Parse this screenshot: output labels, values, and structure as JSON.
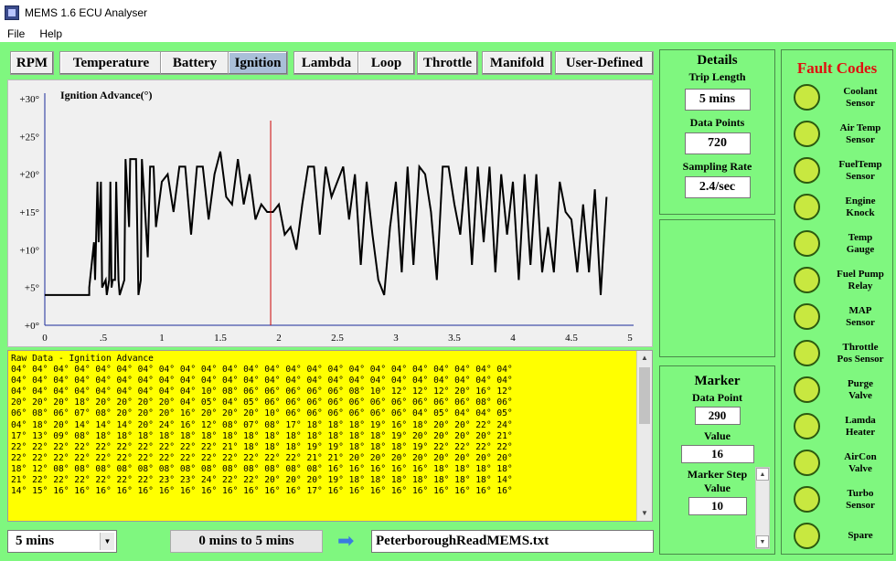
{
  "window": {
    "title": "MEMS 1.6 ECU Analyser"
  },
  "menu": [
    "File",
    "Help"
  ],
  "tabs": [
    {
      "label": "RPM",
      "active": false
    },
    {
      "label": "Temperature",
      "active": false
    },
    {
      "label": "Battery",
      "active": false
    },
    {
      "label": "Ignition",
      "active": true
    },
    {
      "label": "Lambda",
      "active": false
    },
    {
      "label": "Loop",
      "active": false
    },
    {
      "label": "Throttle",
      "active": false
    },
    {
      "label": "Manifold",
      "active": false
    },
    {
      "label": "User-Defined",
      "active": false
    }
  ],
  "chart_data": {
    "type": "line",
    "title": "Ignition Advance(°)",
    "xlabel": "",
    "ylabel": "",
    "xlim": [
      0,
      5
    ],
    "ylim": [
      0,
      30
    ],
    "x_ticks": [
      "0",
      ".5",
      "1",
      "1.5",
      "2",
      "2.5",
      "3",
      "3.5",
      "4",
      "4.5",
      "5"
    ],
    "y_ticks": [
      "+0°",
      "+5°",
      "+10°",
      "+15°",
      "+20°",
      "+25°",
      "+30°"
    ],
    "marker_x": 1.93,
    "line_color": "#000000",
    "marker_color": "#cc0000",
    "axis_color": "#1a2a9a",
    "series": [
      {
        "x": [
          0,
          0.38,
          0.38,
          0.42,
          0.43,
          0.45,
          0.46,
          0.48,
          0.49,
          0.52,
          0.53,
          0.55,
          0.56,
          0.57,
          0.58,
          0.6,
          0.61,
          0.63,
          0.64,
          0.68,
          0.69,
          0.72,
          0.73,
          0.78,
          0.8,
          0.82,
          0.83,
          0.85,
          0.88,
          0.9,
          0.93,
          0.95,
          1.0,
          1.05,
          1.1,
          1.15,
          1.2,
          1.25,
          1.3,
          1.35,
          1.4,
          1.45,
          1.5,
          1.55,
          1.6,
          1.65,
          1.7,
          1.75,
          1.8,
          1.85,
          1.9,
          1.95,
          2.0,
          2.05,
          2.1,
          2.15,
          2.2,
          2.25,
          2.3,
          2.35,
          2.4,
          2.45,
          2.5,
          2.55,
          2.6,
          2.65,
          2.7,
          2.75,
          2.8,
          2.85,
          2.9,
          2.95,
          3.0,
          3.05,
          3.1,
          3.15,
          3.2,
          3.25,
          3.3,
          3.35,
          3.4,
          3.45,
          3.5,
          3.55,
          3.6,
          3.65,
          3.7,
          3.75,
          3.8,
          3.85,
          3.9,
          3.95,
          4.0,
          4.05,
          4.1,
          4.15,
          4.2,
          4.25,
          4.3,
          4.35,
          4.4,
          4.45,
          4.5,
          4.55,
          4.6,
          4.65,
          4.7,
          4.75,
          4.8
        ],
        "y": [
          4,
          4,
          5,
          11,
          6,
          19,
          11,
          19,
          5,
          6,
          4,
          6,
          19,
          5,
          6,
          6,
          19,
          6,
          4,
          6,
          22,
          13,
          22,
          22,
          4,
          6,
          22,
          17,
          9,
          21,
          21,
          13,
          19,
          20,
          15,
          21,
          21,
          12,
          21,
          21,
          14,
          20,
          23,
          17,
          16,
          22,
          16,
          20,
          14,
          16,
          15,
          15,
          16,
          12,
          13,
          10,
          16,
          21,
          21,
          12,
          21,
          17,
          19,
          21,
          14,
          20,
          8,
          19,
          12,
          6,
          4,
          13,
          19,
          7,
          21,
          8,
          21,
          20,
          15,
          6,
          21,
          21,
          16,
          12,
          21,
          8,
          21,
          11,
          21,
          7,
          20,
          12,
          19,
          6,
          20,
          8,
          20,
          7,
          13,
          7,
          19,
          15,
          14,
          7,
          16,
          7,
          18,
          4,
          17
        ]
      }
    ]
  },
  "raw_data": {
    "title": "Raw Data - Ignition Advance",
    "lines": [
      "04° 04° 04° 04° 04° 04° 04° 04° 04° 04° 04° 04° 04° 04° 04° 04° 04° 04° 04° 04° 04° 04° 04° 04°",
      "04° 04° 04° 04° 04° 04° 04° 04° 04° 04° 04° 04° 04° 04° 04° 04° 04° 04° 04° 04° 04° 04° 04° 04°",
      "04° 04° 04° 04° 04° 04° 04° 04° 04° 10° 08° 06° 06° 06° 06° 06° 08° 10° 12° 12° 12° 20° 16° 12°",
      "20° 20° 20° 18° 20° 20° 20° 20° 04° 05° 04° 05° 06° 06° 06° 06° 06° 06° 06° 06° 06° 06° 08° 06°",
      "06° 08° 06° 07° 08° 20° 20° 20° 16° 20° 20° 20° 10° 06° 06° 06° 06° 06° 06° 04° 05° 04° 04° 05°",
      "04° 18° 20° 14° 14° 14° 20° 24° 16° 12° 08° 07° 08° 17° 18° 18° 18° 19° 16° 18° 20° 20° 22° 24°",
      "17° 13° 09° 08° 18° 18° 18° 18° 18° 18° 18° 18° 18° 18° 18° 18° 18° 18° 19° 20° 20° 20° 20° 21°",
      "22° 22° 22° 22° 22° 22° 22° 22° 22° 22° 21° 18° 18° 18° 19° 19° 18° 18° 18° 19° 22° 22° 22° 22°",
      "22° 22° 22° 22° 22° 22° 22° 22° 22° 22° 22° 22° 22° 22° 21° 21° 20° 20° 20° 20° 20° 20° 20° 20°",
      "18° 12° 08° 08° 08° 08° 08° 08° 08° 08° 08° 08° 08° 08° 08° 16° 16° 16° 16° 16° 18° 18° 18° 18°",
      "21° 22° 22° 22° 22° 22° 22° 23° 23° 24° 22° 22° 20° 20° 20° 19° 18° 18° 18° 18° 18° 18° 18° 14°",
      "14° 15° 16° 16° 16° 16° 16° 16° 16° 16° 16° 16° 16° 16° 17° 16° 16° 16° 16° 16° 16° 16° 16° 16°"
    ]
  },
  "details": {
    "heading": "Details",
    "trip_length_label": "Trip Length",
    "trip_length_value": "5 mins",
    "data_points_label": "Data Points",
    "data_points_value": "720",
    "sampling_rate_label": "Sampling Rate",
    "sampling_rate_value": "2.4/sec"
  },
  "marker": {
    "heading": "Marker",
    "data_point_label": "Data Point",
    "data_point_value": "290",
    "value_label": "Value",
    "value_value": "16",
    "step_label_line1": "Marker Step",
    "step_label_line2": "Value",
    "step_value": "10"
  },
  "faults": {
    "heading": "Fault Codes",
    "led_color": "#c8e840",
    "items": [
      {
        "line1": "Coolant",
        "line2": "Sensor"
      },
      {
        "line1": "Air Temp",
        "line2": "Sensor"
      },
      {
        "line1": "FuelTemp",
        "line2": "Sensor"
      },
      {
        "line1": "Engine",
        "line2": "Knock"
      },
      {
        "line1": "Temp",
        "line2": "Gauge"
      },
      {
        "line1": "Fuel Pump",
        "line2": "Relay"
      },
      {
        "line1": "MAP",
        "line2": "Sensor"
      },
      {
        "line1": "Throttle",
        "line2": "Pos Sensor"
      },
      {
        "line1": "Purge",
        "line2": "Valve"
      },
      {
        "line1": "Lamda",
        "line2": "Heater"
      },
      {
        "line1": "AirCon",
        "line2": "Valve"
      },
      {
        "line1": "Turbo",
        "line2": "Sensor"
      },
      {
        "line1": "Spare",
        "line2": ""
      }
    ]
  },
  "bottom": {
    "duration_select": "5 mins",
    "range_text": "0 mins to 5 mins",
    "file_name": "PeterboroughReadMEMS.txt"
  }
}
